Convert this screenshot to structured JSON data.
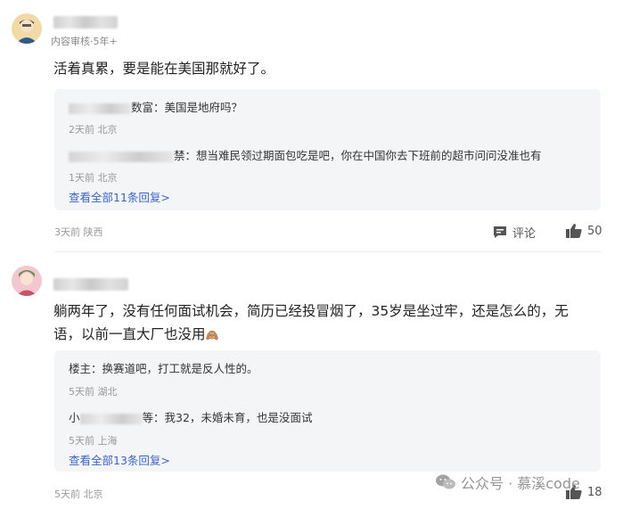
{
  "comments": [
    {
      "meta": "内容审核·5年+",
      "text": "活着真累，要是能在美国那就好了。",
      "replies": [
        {
          "author": "数富",
          "text": "：美国是地府吗？",
          "meta": "2天前 北京"
        },
        {
          "author": "禁",
          "text": "：想当难民领过期面包吃是吧，你在中国你去下班前的超市问问没准也有",
          "meta": "1天前 北京"
        }
      ],
      "see_all": "查看全部11条回复>",
      "footer_meta": "3天前 陕西",
      "comment_label": "评论",
      "like_count": "50"
    },
    {
      "text": "躺两年了，没有任何面试机会，简历已经投冒烟了，35岁是坐过牢，还是怎么的，无语，以前一直大厂也没用",
      "emoji": "🙈",
      "replies": [
        {
          "author": "楼主",
          "text": "：换赛道吧，打工就是反人性的。",
          "meta": "5天前 湖北"
        },
        {
          "author": "小",
          "author_tail": "等",
          "text": "：我32，未婚未育，也是没面试",
          "meta": "5天前 上海"
        }
      ],
      "see_all": "查看全部13条回复>",
      "footer_meta": "5天前 北京",
      "comment_label": "评论",
      "like_count": "18"
    }
  ],
  "watermark": "公众号 · 慕溪code",
  "icons": [
    "avatar-icon",
    "comment-icon",
    "thumbs-up-icon",
    "wechat-icon"
  ]
}
